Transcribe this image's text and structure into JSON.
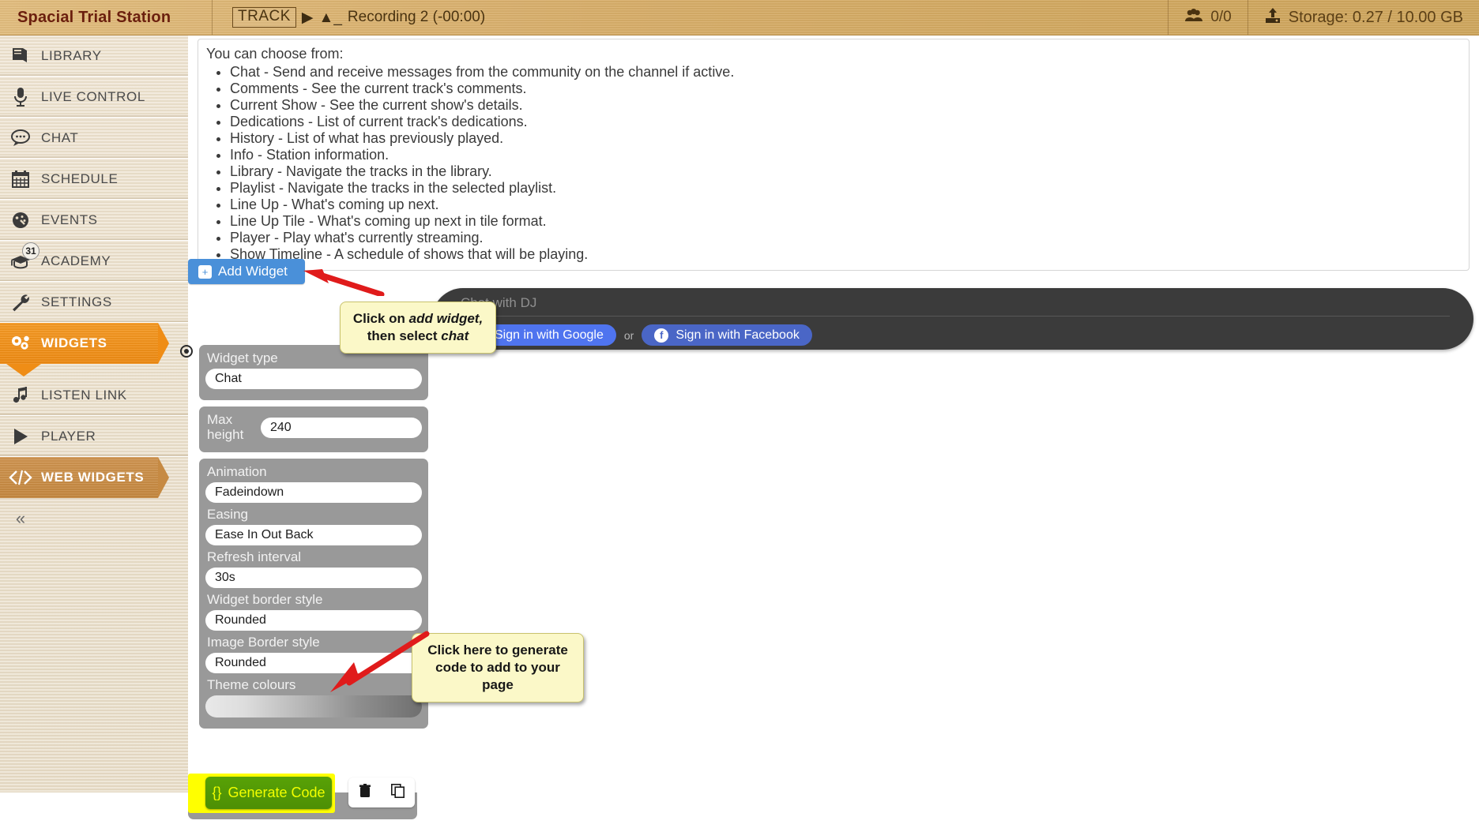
{
  "topbar": {
    "station_title": "Spacial Trial Station",
    "track_badge": "TRACK",
    "play_icon": "play-icon",
    "eject_icon": "eject-icon",
    "track_name": "Recording 2 (-00:00)",
    "listeners_icon": "listeners-icon",
    "listeners": "0/0",
    "upload_icon": "upload-icon",
    "storage": "Storage: 0.27 / 10.00 GB"
  },
  "sidebar": {
    "items": [
      {
        "label": "LIBRARY",
        "icon": "book-icon",
        "state": "normal"
      },
      {
        "label": "LIVE CONTROL",
        "icon": "microphone-icon",
        "state": "normal"
      },
      {
        "label": "CHAT",
        "icon": "chat-bubble-icon",
        "state": "normal"
      },
      {
        "label": "SCHEDULE",
        "icon": "calendar-icon",
        "state": "normal"
      },
      {
        "label": "EVENTS",
        "icon": "gauge-icon",
        "state": "normal"
      },
      {
        "label": "ACADEMY",
        "icon": "graduation-cap-icon",
        "state": "normal",
        "badge": "31"
      },
      {
        "label": "SETTINGS",
        "icon": "wrench-icon",
        "state": "normal"
      },
      {
        "label": "WIDGETS",
        "icon": "gears-icon",
        "state": "active"
      },
      {
        "label": "LISTEN LINK",
        "icon": "music-note-icon",
        "state": "normal"
      },
      {
        "label": "PLAYER",
        "icon": "play-triangle-icon",
        "state": "normal"
      },
      {
        "label": "WEB WIDGETS",
        "icon": "code-brackets-icon",
        "state": "selected"
      }
    ],
    "collapse_icon": "double-chevron-left-icon"
  },
  "info": {
    "lead": "You can choose from:",
    "items": [
      "Chat - Send and receive messages from the community on the channel if active.",
      "Comments - See the current track's comments.",
      "Current Show - See the current show's details.",
      "Dedications - List of current track's dedications.",
      "History - List of what has previously played.",
      "Info - Station information.",
      "Library - Navigate the tracks in the library.",
      "Playlist - Navigate the tracks in the selected playlist.",
      "Line Up - What's coming up next.",
      "Line Up Tile - What's coming up next in tile format.",
      "Player - Play what's currently streaming.",
      "Show Timeline - A schedule of shows that will be playing."
    ]
  },
  "actions": {
    "add_widget_label": "Add Widget",
    "add_widget_icon": "plus-square-icon",
    "generate_code_label": "Generate Code",
    "generate_code_icon": "curly-braces-icon",
    "delete_icon": "trash-icon",
    "copy_icon": "copy-icon"
  },
  "tooltips": {
    "add_widget": {
      "line1": "Click on ",
      "em1": "add widget,",
      "line2": "then select ",
      "em2": "chat"
    },
    "generate_code": "Click here to generate code to add to your page"
  },
  "settings": {
    "widget_type": {
      "label": "Widget type",
      "value": "Chat"
    },
    "max_height": {
      "label": "Max height",
      "value": "240"
    },
    "animation": {
      "label": "Animation",
      "value": "Fadeindown"
    },
    "easing": {
      "label": "Easing",
      "value": "Ease In Out Back"
    },
    "refresh_interval": {
      "label": "Refresh interval",
      "value": "30s"
    },
    "widget_border_style": {
      "label": "Widget border style",
      "value": "Rounded"
    },
    "image_border_style": {
      "label": "Image Border style",
      "value": "Rounded"
    },
    "theme_colours": {
      "label": "Theme colours"
    }
  },
  "preview": {
    "title": "Chat with DJ",
    "google_label": "Sign in with Google",
    "or_label": "or",
    "facebook_label": "Sign in with Facebook",
    "google_icon": "google-g-icon",
    "facebook_icon": "facebook-f-icon"
  },
  "colors": {
    "accent_orange": "#ef8d16",
    "accent_brown": "#c68a43",
    "primary_blue": "#4a90d9",
    "green": "#4d8f05",
    "highlight_yellow": "#ffff00",
    "tooltip_bg": "#fbf8c8",
    "topbar_tan": "#d8ae6a"
  }
}
